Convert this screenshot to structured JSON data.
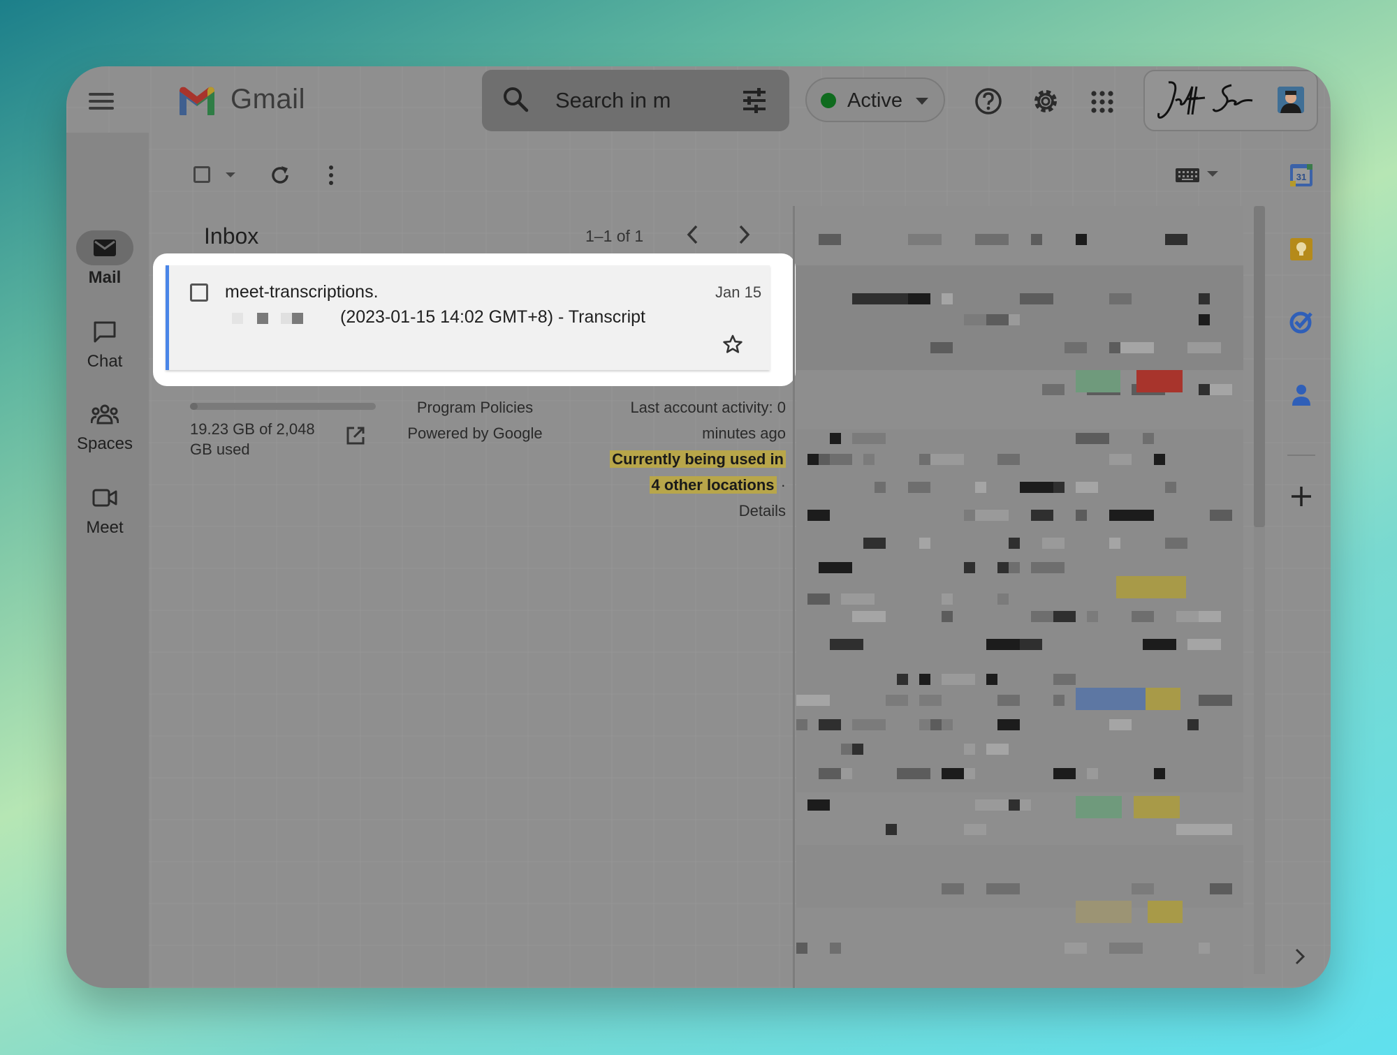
{
  "app": {
    "name": "Gmail"
  },
  "header": {
    "search_placeholder": "Search in m",
    "status_label": "Active",
    "status_color": "#0f6b1e",
    "icons": [
      "menu-icon",
      "search-icon",
      "tune-icon",
      "help-icon",
      "gear-icon",
      "apps-icon"
    ]
  },
  "nav": {
    "items": [
      {
        "label": "Mail",
        "icon": "mail-icon",
        "selected": true
      },
      {
        "label": "Chat",
        "icon": "chat-icon",
        "selected": false
      },
      {
        "label": "Spaces",
        "icon": "spaces-icon",
        "selected": false
      },
      {
        "label": "Meet",
        "icon": "meet-icon",
        "selected": false
      }
    ]
  },
  "inbox": {
    "title": "Inbox",
    "pager_text": "1–1 of 1",
    "email": {
      "sender": "meet-transcriptions.",
      "subject": "(2023-01-15 14:02 GMT+8) - Transcript",
      "date": "Jan 15",
      "unread_accent": "#4a86e8"
    }
  },
  "footer": {
    "storage_text": "19.23 GB of 2,048 GB used",
    "storage_fraction": 0.0094,
    "program_policies": "Program Policies",
    "powered_by": "Powered by Google",
    "activity_line1": "Last account activity: 0",
    "activity_line2": "minutes ago",
    "locations_line1": "Currently being used in",
    "locations_line2": "4 other locations",
    "details": "Details"
  },
  "side_panel": {
    "calendar_day": "31",
    "icons": [
      "calendar-icon",
      "keep-icon",
      "tasks-icon",
      "contacts-icon",
      "add-icon"
    ]
  }
}
